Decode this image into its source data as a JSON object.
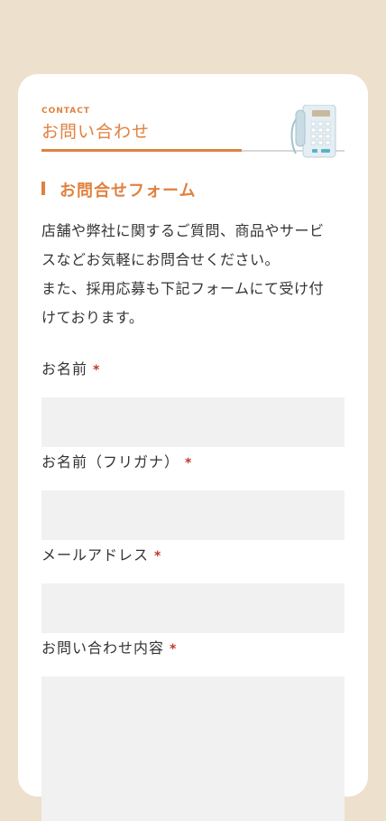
{
  "header": {
    "eyebrow": "CONTACT",
    "title": "お問い合わせ",
    "illustration": "telephone-icon"
  },
  "section": {
    "title": "お問合せフォーム"
  },
  "intro": {
    "lines": [
      "店舗や弊社に関するご質問、商品やサービ",
      "スなどお気軽にお問合せください。",
      "また、採用応募も下記フォームにて受け付",
      "けております。"
    ]
  },
  "form": {
    "required_mark": "*",
    "fields": [
      {
        "label": "お名前",
        "value": ""
      },
      {
        "label": "お名前（フリガナ）",
        "value": ""
      },
      {
        "label": "メールアドレス",
        "value": ""
      },
      {
        "label": "お問い合わせ内容",
        "value": ""
      }
    ]
  },
  "colors": {
    "background": "#ede0cc",
    "accent": "#e0813f",
    "required": "#c0392b",
    "input_background": "#f1f1f1"
  }
}
